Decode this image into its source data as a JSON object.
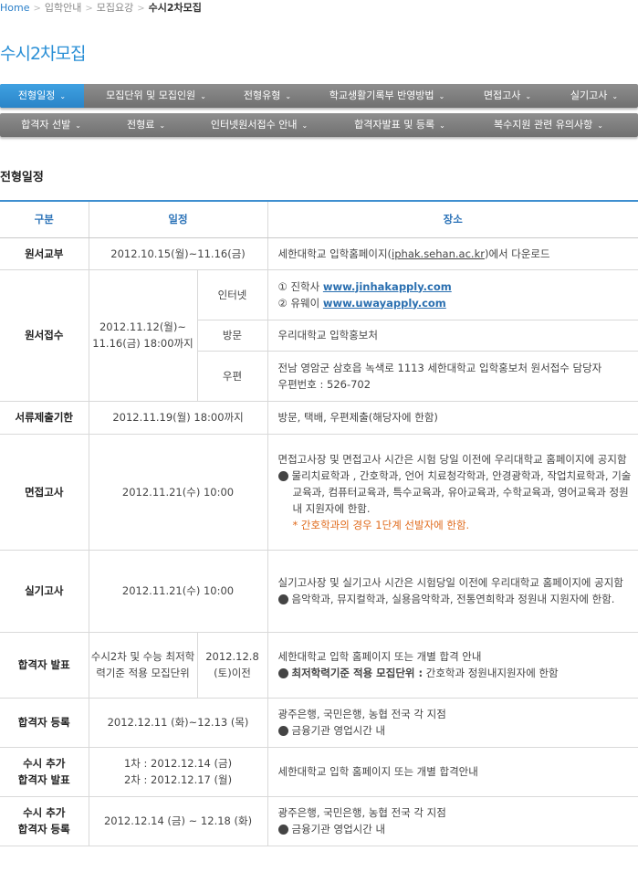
{
  "breadcrumb": {
    "home": "Home",
    "level1": "입학안내",
    "level2": "모집요강",
    "current": "수시2차모집"
  },
  "page_title": "수시2차모집",
  "tabs": {
    "row1": [
      {
        "label": "전형일정",
        "active": true
      },
      {
        "label": "모집단위 및 모집인원"
      },
      {
        "label": "전형유형"
      },
      {
        "label": "학교생활기록부 반영방법"
      },
      {
        "label": "면접고사"
      },
      {
        "label": "실기고사"
      }
    ],
    "row2": [
      {
        "label": "합격자 선발"
      },
      {
        "label": "전형료"
      },
      {
        "label": "인터넷원서접수 안내"
      },
      {
        "label": "합격자발표 및 등록"
      },
      {
        "label": "복수지원 관련 유의사항"
      }
    ]
  },
  "section_title": "전형일정",
  "table": {
    "headers": {
      "gubun": "구분",
      "schedule": "일정",
      "place": "장소"
    },
    "wonseo_gyobu": {
      "gubun": "원서교부",
      "date": "2012.10.15(월)~11.16(금)",
      "place_pre": "세한대학교 입학홈페이지(",
      "place_link": "iphak.sehan.ac.kr",
      "place_post": ")에서 다운로드"
    },
    "wonseo_jeopsu": {
      "gubun": "원서접수",
      "date": "2012.11.12(월)~ 11.16(금) 18:00까지",
      "internet": {
        "sub": "인터넷",
        "line1_prefix": "① 진학사 ",
        "line1_link": "www.jinhakapply.com",
        "line2_prefix": "② 유웨이 ",
        "line2_link": "www.uwayapply.com"
      },
      "visit": {
        "sub": "방문",
        "place": "우리대학교 입학홍보처"
      },
      "mail": {
        "sub": "우편",
        "line1": "전남 영암군 삼호읍 녹색로 1113 세한대학교 입학홍보처 원서접수 담당자",
        "line2": "우편번호 : 526-702"
      }
    },
    "documents": {
      "gubun": "서류제출기한",
      "date": "2012.11.19(월) 18:00까지",
      "place": "방문, 택배, 우편제출(해당자에 한함)"
    },
    "interview": {
      "gubun": "면접고사",
      "date": "2012.11.21(수) 10:00",
      "line1": "면접고사장 및 면접고사 시간은 시험 당일 이전에 우리대학교 홈페이지에 공지함",
      "bullet": "물리치료학과 , 간호학과, 언어 치료청각학과, 안경광학과, 작업치료학과, 기술교육과, 컴퓨터교육과, 특수교육과, 유아교육과, 수학교육과, 영어교육과 정원내 지원자에 한함.",
      "note": "* 간호학과의 경우 1단계 선발자에 한함."
    },
    "practical": {
      "gubun": "실기고사",
      "date": "2012.11.21(수) 10:00",
      "line1": "실기고사장 및 실기고사 시간은 시험당일 이전에 우리대학교 홈페이지에 공지함",
      "bullet": "음악학과, 뮤지컬학과, 실용음악학과, 전통연희학과 정원내 지원자에 한함."
    },
    "announce": {
      "gubun": "합격자 발표",
      "sub": "수시2차 및 수능 최저학력기준 적용 모집단위",
      "date": "2012.12.8 (토)이전",
      "line1": "세한대학교 입학 홈페이지 또는 개별 합격 안내",
      "bullet_bold": "최저학력기준 적용 모집단위 :",
      "bullet_rest": " 간호학과 정원내지원자에 한함"
    },
    "registration": {
      "gubun": "합격자 등록",
      "date": "2012.12.11 (화)~12.13 (목)",
      "line1": "광주은행, 국민은행, 농협 전국 각 지점",
      "bullet": "금융기관 영업시간 내"
    },
    "extra_announce": {
      "gubun1": "수시 추가",
      "gubun2": "합격자 발표",
      "date1": "1차 : 2012.12.14 (금)",
      "date2": "2차 : 2012.12.17 (월)",
      "place": "세한대학교 입학 홈페이지 또는 개별 합격안내"
    },
    "extra_registration": {
      "gubun1": "수시 추가",
      "gubun2": "합격자 등록",
      "date": "2012.12.14 (금) ~ 12.18 (화)",
      "line1": "광주은행, 국민은행, 농협 전국 각 지점",
      "bullet": "금융기관 영업시간 내"
    }
  }
}
